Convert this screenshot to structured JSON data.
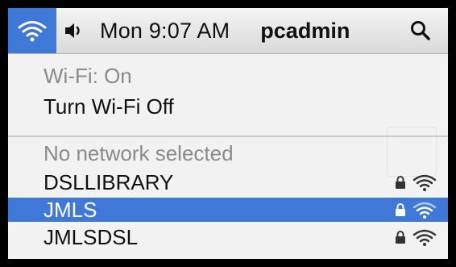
{
  "menubar": {
    "clock": "Mon 9:07 AM",
    "username": "pcadmin",
    "icons": [
      "wifi-icon",
      "volume-icon",
      "spotlight-search-icon"
    ]
  },
  "wifi_menu": {
    "status": "Wi-Fi: On",
    "toggle_label": "Turn Wi-Fi Off",
    "network_status": "No network selected",
    "networks": [
      {
        "name": "DSLLIBRARY",
        "secured": true,
        "selected": false
      },
      {
        "name": "JMLS",
        "secured": true,
        "selected": true
      },
      {
        "name": "JMLSDSL",
        "secured": true,
        "selected": false
      }
    ]
  },
  "colors": {
    "accent": "#3f78d6",
    "menu_background": "#f2f2f2",
    "disabled_text": "#8a8a8a",
    "border": "#000000"
  }
}
